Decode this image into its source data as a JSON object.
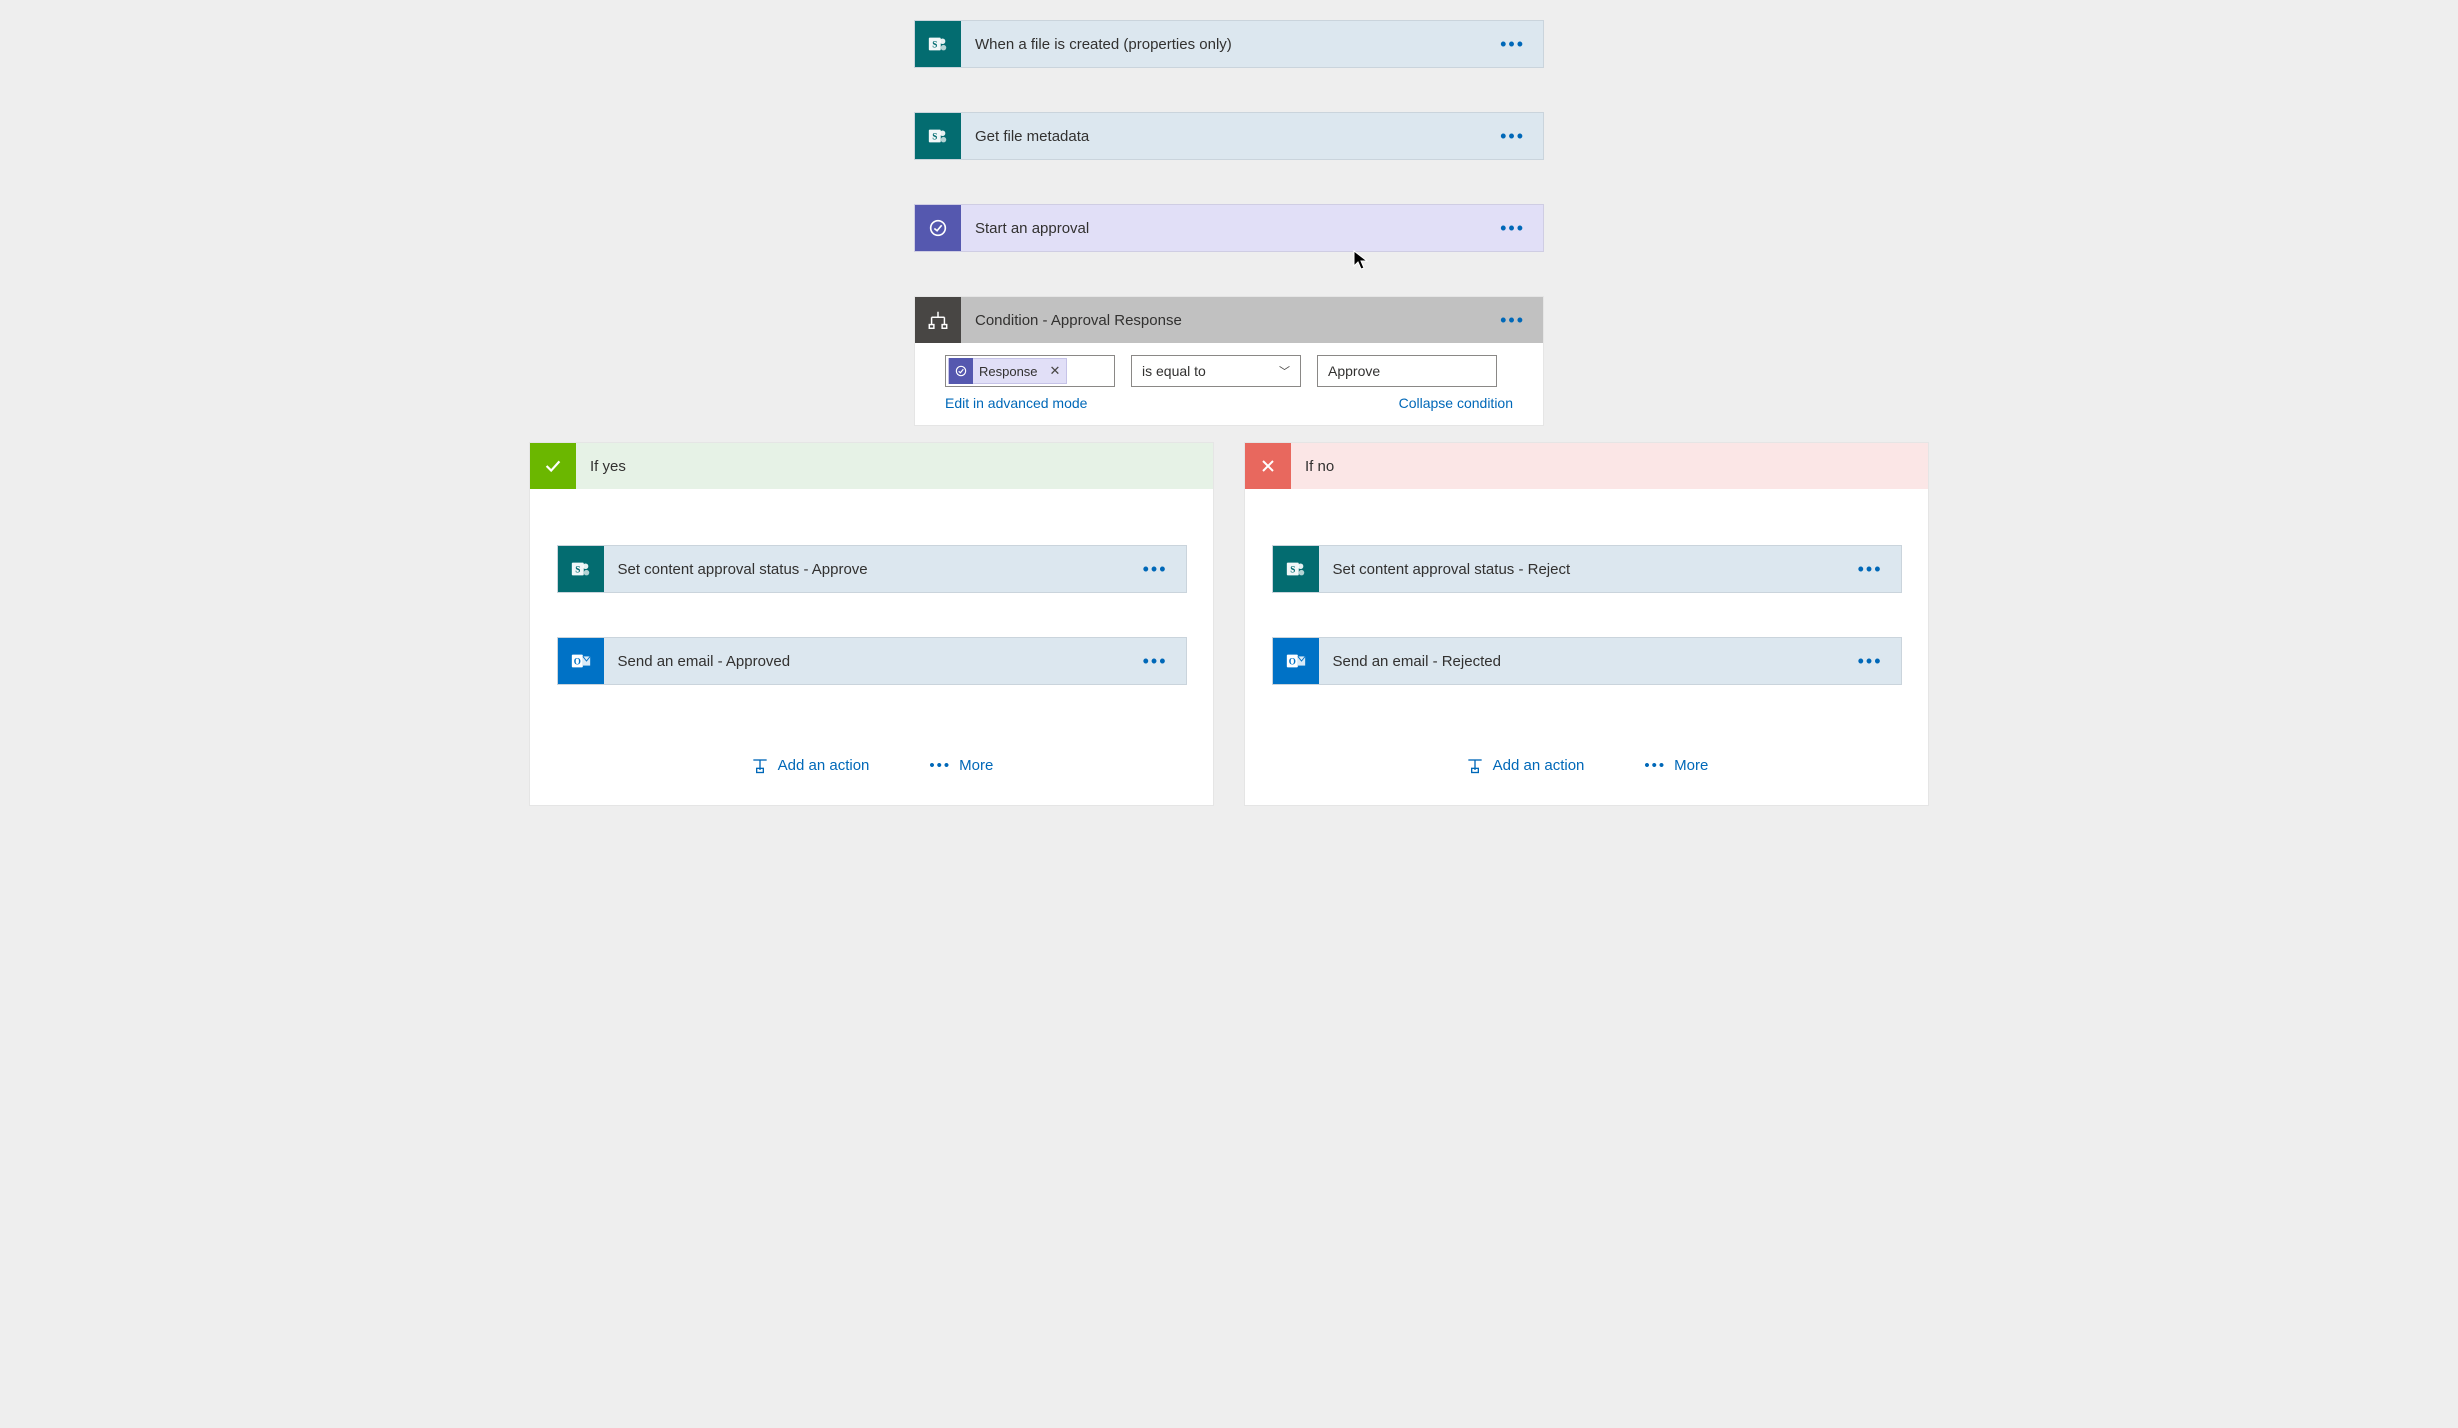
{
  "steps": {
    "trigger": "When a file is created (properties only)",
    "getMeta": "Get file metadata",
    "approval": "Start an approval",
    "condition": "Condition - Approval Response"
  },
  "condition": {
    "chip": "Response",
    "operator": "is equal to",
    "value": "Approve",
    "editLink": "Edit in advanced mode",
    "collapseLink": "Collapse condition"
  },
  "branches": {
    "yes": {
      "title": "If yes",
      "step1": "Set content approval status - Approve",
      "step2": "Send an email - Approved"
    },
    "no": {
      "title": "If no",
      "step1": "Set content approval status - Reject",
      "step2": "Send an email - Rejected"
    },
    "addAction": "Add an action",
    "more": "More"
  }
}
